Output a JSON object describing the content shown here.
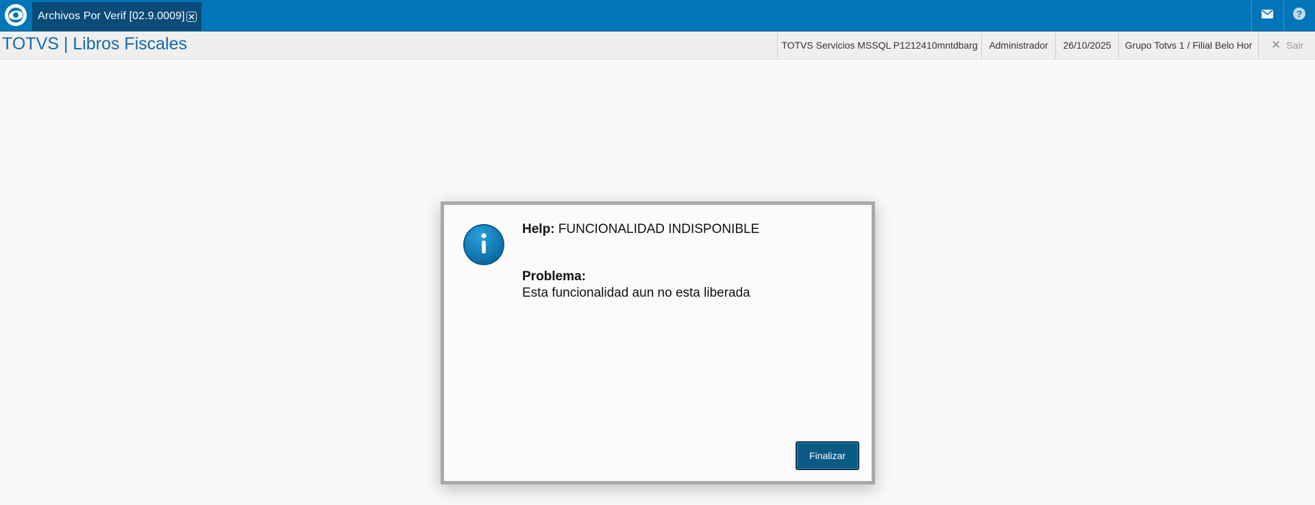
{
  "topbar": {
    "tab_label": "Archivos Por Verif [02.9.0009]"
  },
  "subbar": {
    "app_title": "TOTVS | Libros Fiscales",
    "environment": "TOTVS Servicios MSSQL P1212410mntdbarg",
    "user": "Administrador",
    "date": "26/10/2025",
    "group": "Grupo Totvs 1 / Filial Belo Hor",
    "exit_label": "Sair"
  },
  "dialog": {
    "help_label": "Help:",
    "help_code": "FUNCIONALIDAD INDISPONIBLE",
    "problem_label": "Problema:",
    "problem_text": "Esta funcionalidad aun no esta liberada",
    "finish_button": "Finalizar"
  },
  "colors": {
    "topbar": "#0076b8",
    "tab_active": "#0a4b78",
    "title": "#1469a6",
    "button": "#0a5a86"
  },
  "icons": [
    "totvs-logo-icon",
    "tab-close-icon",
    "mail-icon",
    "help-icon",
    "close-icon",
    "info-icon"
  ]
}
